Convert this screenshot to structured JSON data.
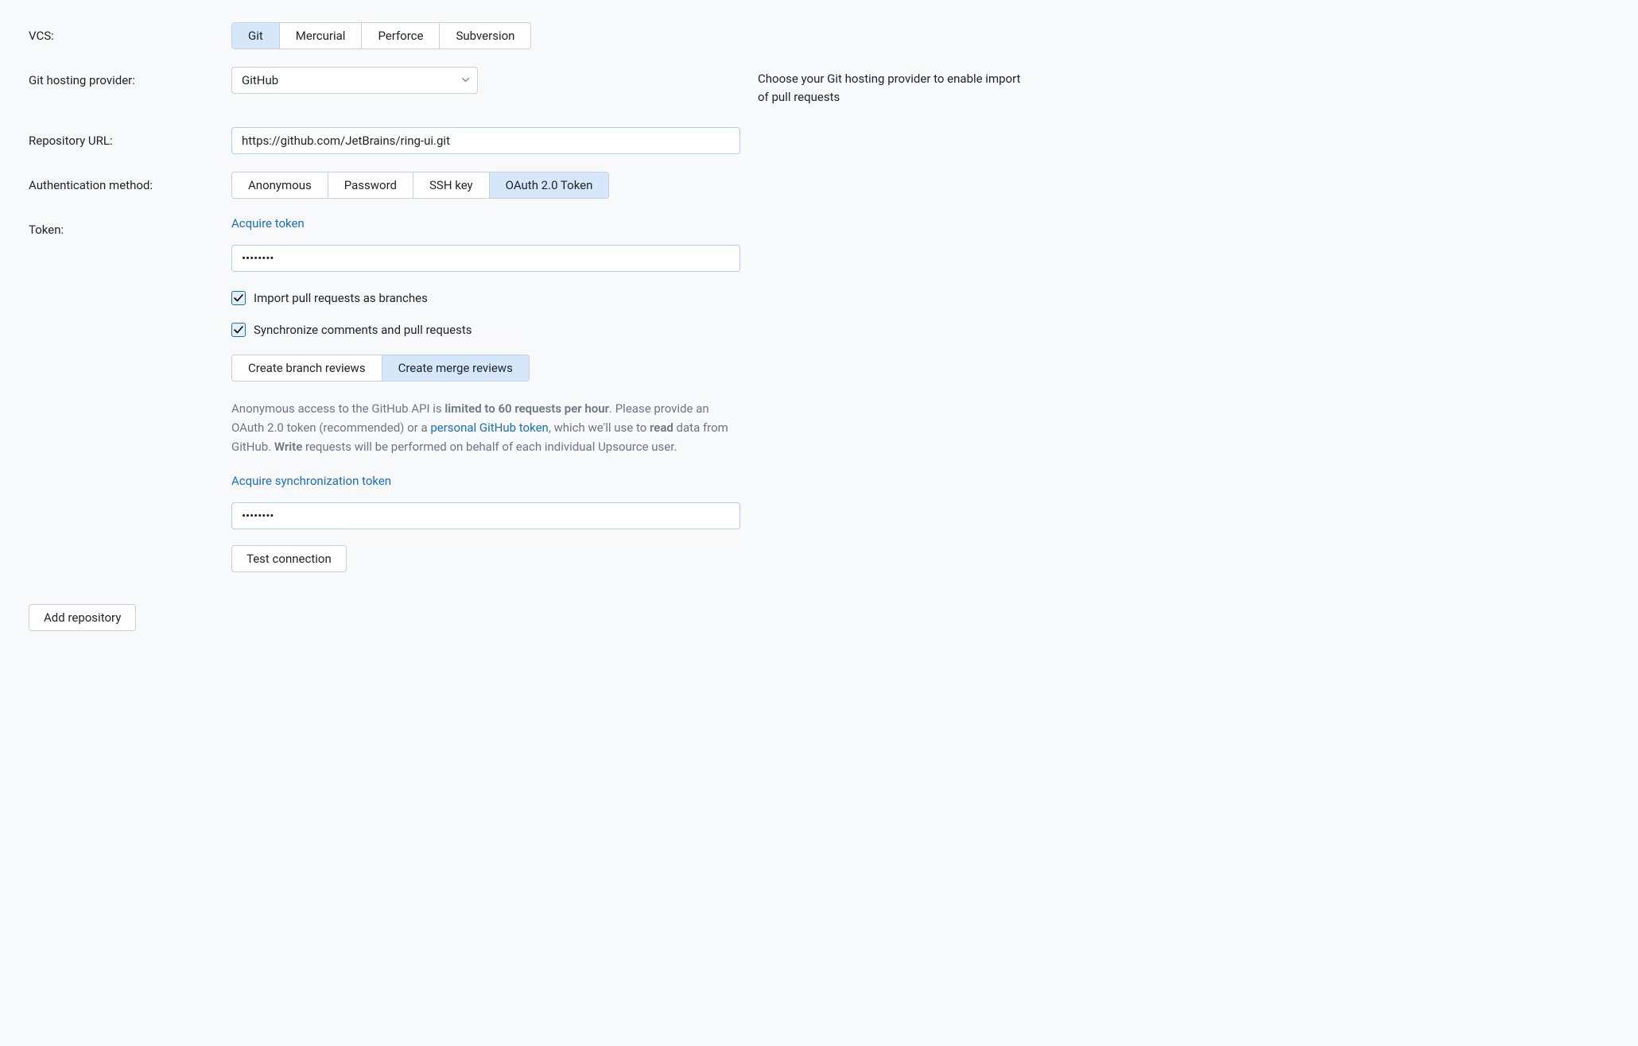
{
  "labels": {
    "vcs": "VCS:",
    "git_hosting_provider": "Git hosting provider:",
    "repository_url": "Repository URL:",
    "authentication_method": "Authentication method:",
    "token": "Token:"
  },
  "vcs_options": {
    "git": "Git",
    "mercurial": "Mercurial",
    "perforce": "Perforce",
    "subversion": "Subversion"
  },
  "provider": {
    "selected": "GitHub"
  },
  "help": {
    "provider": "Choose your Git hosting provider to enable import of pull requests"
  },
  "repo_url": {
    "value": "https://github.com/JetBrains/ring-ui.git"
  },
  "auth_options": {
    "anonymous": "Anonymous",
    "password": "Password",
    "ssh": "SSH key",
    "oauth": "OAuth 2.0 Token"
  },
  "token": {
    "acquire_link": "Acquire token",
    "value": "••••••••"
  },
  "checkboxes": {
    "import_pr": "Import pull requests as branches",
    "sync_comments": "Synchronize comments and pull requests"
  },
  "review_options": {
    "branch": "Create branch reviews",
    "merge": "Create merge reviews"
  },
  "info": {
    "pre1": "Anonymous access to the GitHub API is ",
    "bold1": "limited to 60 requests per hour",
    "post1": ". Please provide an OAuth 2.0 token (recommended) or a ",
    "link": "personal GitHub token",
    "post2": ", which we'll use to ",
    "bold2": "read",
    "mid2": " data from GitHub. ",
    "bold3": "Write",
    "post3": " requests will be performed on behalf of each individual Upsource user."
  },
  "sync_token": {
    "acquire_link": "Acquire synchronization token",
    "value": "••••••••"
  },
  "buttons": {
    "test_connection": "Test connection",
    "add_repository": "Add repository"
  }
}
